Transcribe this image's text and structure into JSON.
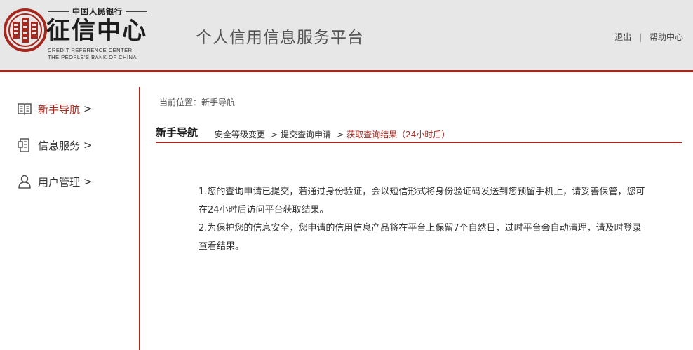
{
  "header": {
    "brand_cn_top": "中国人民银行",
    "brand_name": "征信中心",
    "brand_en_line1": "CREDIT REFERENCE CENTER",
    "brand_en_line2": "THE PEOPLE'S BANK OF CHINA",
    "platform_title": "个人信用信息服务平台",
    "links": {
      "logout": "退出",
      "separator": "|",
      "help": "帮助中心"
    },
    "accent_color": "#a5281f"
  },
  "sidebar": {
    "items": [
      {
        "label": "新手导航",
        "arrow": ">",
        "icon": "book-icon",
        "active": true
      },
      {
        "label": "信息服务",
        "arrow": ">",
        "icon": "document-icon",
        "active": false
      },
      {
        "label": "用户管理",
        "arrow": ">",
        "icon": "user-icon",
        "active": false
      }
    ]
  },
  "main": {
    "breadcrumb": "当前位置：新手导航",
    "section_title": "新手导航",
    "steps": {
      "step1": "安全等级变更",
      "arrow1": " -> ",
      "step2": "提交查询申请",
      "arrow2": " -> ",
      "step3": "获取查询结果（24小时后）"
    },
    "message_lines": [
      "1.您的查询申请已提交，若通过身份验证，会以短信形式将身份验证码发送到您预留手机上，请妥善保管，您可在24小时后访问平台获取结果。",
      "2.为保护您的信息安全，您申请的信用信息产品将在平台上保留7个自然日，过时平台会自动清理，请及时登录查看结果。"
    ]
  }
}
